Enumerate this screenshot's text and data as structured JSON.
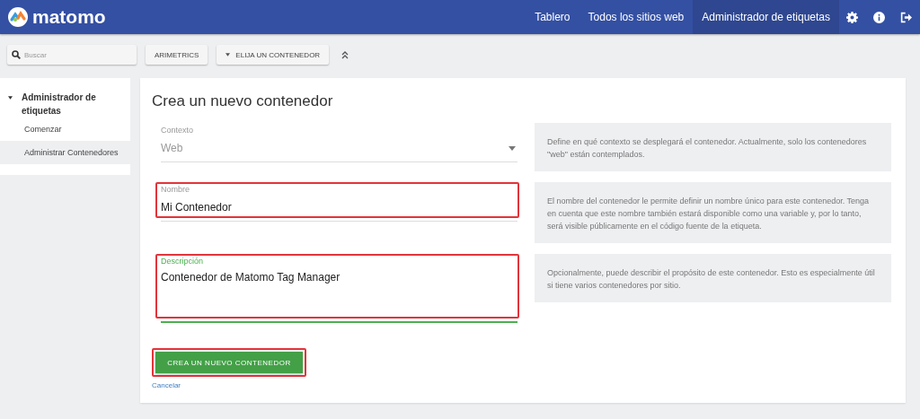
{
  "header": {
    "logo": "matomo",
    "nav": [
      {
        "label": "Tablero",
        "selected": false
      },
      {
        "label": "Todos los sitios web",
        "selected": false
      },
      {
        "label": "Administrador de etiquetas",
        "selected": true
      }
    ]
  },
  "toolbar": {
    "search": {
      "placeholder": "Buscar"
    },
    "site_button": "ARIMETRICS",
    "container_button": "ELIJA UN CONTENEDOR"
  },
  "sidebar": {
    "section": "Administrador de etiquetas",
    "expanded": true,
    "items": [
      {
        "label": "Comenzar",
        "selected": false
      },
      {
        "label": "Administrar Contenedores",
        "selected": true
      }
    ]
  },
  "form": {
    "title": "Crea un nuevo contenedor",
    "fields": [
      {
        "kind": "select",
        "label": "Contexto",
        "value": "Web",
        "focused": false,
        "highlighted": false,
        "help": "Define en qué contexto se desplegará el contenedor. Actualmente, solo los contenedores \"web\" están contemplados."
      },
      {
        "kind": "text",
        "label": "Nombre",
        "value": "Mi Contenedor",
        "focused": false,
        "highlighted": true,
        "help": "El nombre del contenedor le permite definir un nombre único para este contenedor. Tenga en cuenta que este nombre también estará disponible como una variable y, por lo tanto, será visible públicamente en el código fuente de la etiqueta."
      },
      {
        "kind": "textarea",
        "label": "Descripción",
        "value": "Contenedor de Matomo Tag Manager",
        "focused": true,
        "highlighted": true,
        "help": "Opcionalmente, puede describir el propósito de este contenedor. Esto es especialmente útil si tiene varios contenedores por sitio."
      }
    ],
    "submit": {
      "label": "CREA UN NUEVO CONTENEDOR",
      "highlighted": true
    },
    "cancel": "Cancelar"
  }
}
